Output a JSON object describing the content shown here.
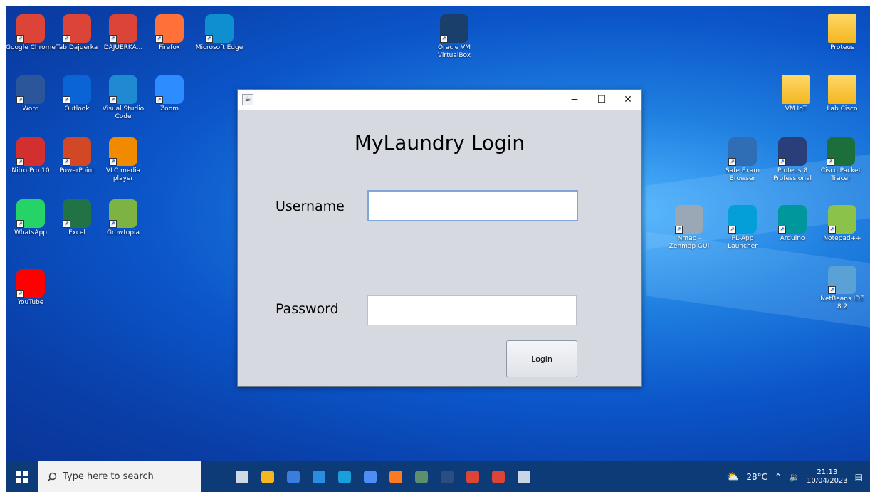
{
  "desktop": {
    "icons_left": [
      {
        "label": "Google Chrome",
        "icon": "chrome-icon",
        "color": "#db4437"
      },
      {
        "label": "Tab Dajuerka",
        "icon": "chrome-icon",
        "color": "#db4437"
      },
      {
        "label": "DAJUERKA...",
        "icon": "chrome-icon",
        "color": "#db4437"
      },
      {
        "label": "Firefox",
        "icon": "firefox-icon",
        "color": "#ff7139"
      },
      {
        "label": "Microsoft Edge",
        "icon": "edge-icon",
        "color": "#0f8fcf"
      },
      {
        "label": "Word",
        "icon": "word-icon",
        "color": "#2b579a"
      },
      {
        "label": "Outlook",
        "icon": "outlook-icon",
        "color": "#0a64d6"
      },
      {
        "label": "Visual Studio Code",
        "icon": "vscode-icon",
        "color": "#1f8ad2"
      },
      {
        "label": "Zoom",
        "icon": "zoom-icon",
        "color": "#2d8cff"
      },
      {
        "label": "Nitro Pro 10",
        "icon": "nitro-icon",
        "color": "#d32f2f"
      },
      {
        "label": "PowerPoint",
        "icon": "powerpoint-icon",
        "color": "#d24726"
      },
      {
        "label": "VLC media player",
        "icon": "vlc-icon",
        "color": "#f08a00"
      },
      {
        "label": "WhatsApp",
        "icon": "whatsapp-icon",
        "color": "#25d366"
      },
      {
        "label": "Excel",
        "icon": "excel-icon",
        "color": "#217346"
      },
      {
        "label": "Growtopia",
        "icon": "growtopia-icon",
        "color": "#7cb342"
      },
      {
        "label": "YouTube",
        "icon": "youtube-icon",
        "color": "#ff0000"
      }
    ],
    "icons_center": [
      {
        "label": "Oracle VM VirtualBox",
        "icon": "virtualbox-icon",
        "color": "#1b3f6b"
      }
    ],
    "icons_right": [
      {
        "label": "Proteus",
        "icon": "folder-icon",
        "color": "#f3b720"
      },
      {
        "label": "VM IoT",
        "icon": "folder-icon",
        "color": "#f3b720"
      },
      {
        "label": "Lab Cisco",
        "icon": "folder-icon",
        "color": "#f3b720"
      },
      {
        "label": "Safe Exam Browser",
        "icon": "safe-exam-browser-icon",
        "color": "#2f6db5"
      },
      {
        "label": "Proteus 8 Professional",
        "icon": "proteus-icon",
        "color": "#2a3f7a"
      },
      {
        "label": "Cisco Packet Tracer",
        "icon": "packet-tracer-icon",
        "color": "#1c6e3a"
      },
      {
        "label": "Nmap - Zenmap GUI",
        "icon": "zenmap-icon",
        "color": "#9aa8b5"
      },
      {
        "label": "PL-App Launcher",
        "icon": "cisco-icon",
        "color": "#049fd9"
      },
      {
        "label": "Arduino",
        "icon": "arduino-icon",
        "color": "#00979c"
      },
      {
        "label": "Notepad++",
        "icon": "notepadpp-icon",
        "color": "#8bc34a"
      },
      {
        "label": "NetBeans IDE 8.2",
        "icon": "netbeans-icon",
        "color": "#5aa1d6"
      }
    ]
  },
  "window": {
    "title_bar_icon": "java-icon",
    "minimize": "−",
    "maximize": "☐",
    "close": "✕",
    "heading": "MyLaundry Login",
    "username_label": "Username",
    "username_value": "",
    "password_label": "Password",
    "password_value": "",
    "login_label": "Login"
  },
  "taskbar": {
    "search_placeholder": "Type here to search",
    "apps": [
      "task-view-icon",
      "file-explorer-icon",
      "store-icon",
      "mail-icon",
      "edge-icon",
      "copilot-icon",
      "xampp-icon",
      "app-icon",
      "virtualbox-icon",
      "chrome-icon",
      "chrome-icon",
      "java-icon"
    ],
    "weather": "28°C",
    "time": "21:13",
    "date": "10/04/2023"
  },
  "colors": {
    "window_bg": "#d6d9df",
    "desktop_blue": "#0b55c9",
    "taskbar": "#0c3b78"
  }
}
